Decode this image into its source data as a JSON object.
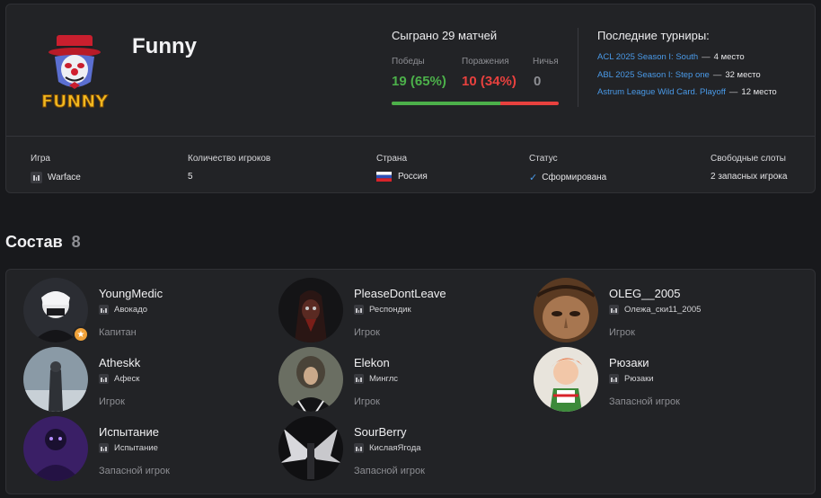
{
  "team": {
    "name": "Funny",
    "logo_text": "FUNNY",
    "stats": {
      "title": "Сыграно 29 матчей",
      "wins_label": "Победы",
      "losses_label": "Поражения",
      "draws_label": "Ничья",
      "wins_value": "19 (65%)",
      "losses_value": "10 (34%)",
      "draws_value": "0",
      "win_fraction": 0.65,
      "colors": {
        "wins": "#4cb04a",
        "losses": "#e8413e",
        "draws": "#8d8e93"
      }
    },
    "tournaments": {
      "title": "Последние турниры:",
      "items": [
        {
          "name": "ACL 2025 Season I: South",
          "place": "4 место"
        },
        {
          "name": "ABL 2025 Season I: Step one",
          "place": "32 место"
        },
        {
          "name": "Astrum League Wild Card. Playoff",
          "place": "12 место"
        }
      ]
    },
    "info": {
      "game_label": "Игра",
      "game_value": "Warface",
      "players_label": "Количество игроков",
      "players_value": "5",
      "country_label": "Страна",
      "country_value": "Россия",
      "status_label": "Статус",
      "status_value": "Сформирована",
      "slots_label": "Свободные слоты",
      "slots_value": "2 запасных игрока"
    }
  },
  "roster": {
    "title": "Состав",
    "count": "8",
    "players": [
      {
        "name": "YoungMedic",
        "game_nick": "Авокадо",
        "role": "Капитан",
        "captain": true
      },
      {
        "name": "PleaseDontLeave",
        "game_nick": "Респондик",
        "role": "Игрок"
      },
      {
        "name": "OLEG__2005",
        "game_nick": "Олежа_ски11_2005",
        "role": "Игрок"
      },
      {
        "name": "Atheskk",
        "game_nick": "Афеск",
        "role": "Игрок"
      },
      {
        "name": "Elekon",
        "game_nick": "Минглс",
        "role": "Игрок"
      },
      {
        "name": "Рюзаки",
        "game_nick": "Рюзаки",
        "role": "Запасной игрок"
      },
      {
        "name": "Испытание",
        "game_nick": "Испытание",
        "role": "Запасной игрок"
      },
      {
        "name": "SourBerry",
        "game_nick": "КислаяЯгода",
        "role": "Запасной игрок"
      }
    ]
  }
}
